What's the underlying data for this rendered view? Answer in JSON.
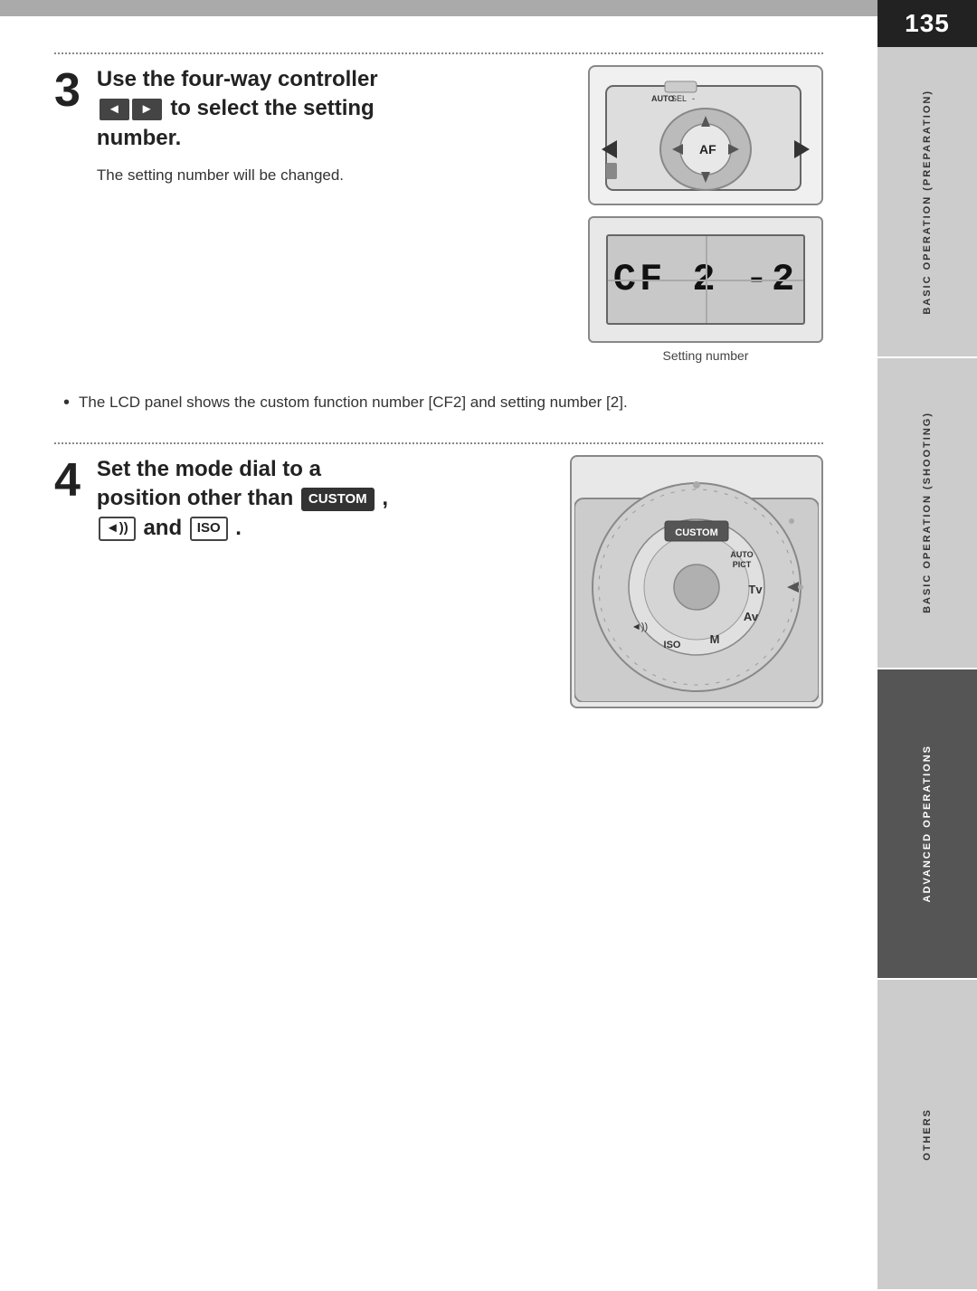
{
  "page": {
    "number": "135",
    "top_bar_color": "#aaa"
  },
  "sidebar": {
    "tabs": [
      {
        "id": "basic-prep",
        "label": "BASIC OPERATION\n(PREPARATION)",
        "dark": false
      },
      {
        "id": "basic-shoot",
        "label": "BASIC OPERATION\n(SHOOTING)",
        "dark": false
      },
      {
        "id": "advanced",
        "label": "ADVANCED OPERATIONS",
        "dark": true
      },
      {
        "id": "others",
        "label": "OTHERS",
        "dark": false
      }
    ]
  },
  "section3": {
    "number": "3",
    "heading_line1": "Use the four-way controller",
    "heading_line2": "to select the setting",
    "heading_line3": "number.",
    "left_arrow": "◄",
    "right_arrow": "►",
    "body": "The setting number will be changed.",
    "lcd_display": "CF 2 -2",
    "setting_number_label": "Setting number"
  },
  "bullet_note": "The LCD panel shows the custom function number [CF2] and setting number [2].",
  "section4": {
    "number": "4",
    "heading_line1": "Set the mode dial to a",
    "heading_line2": "position other than",
    "custom_badge": "CUSTOM",
    "comma": ",",
    "sound_badge": "◄))",
    "and_text": "and",
    "iso_badge": "ISO",
    "period": "."
  }
}
